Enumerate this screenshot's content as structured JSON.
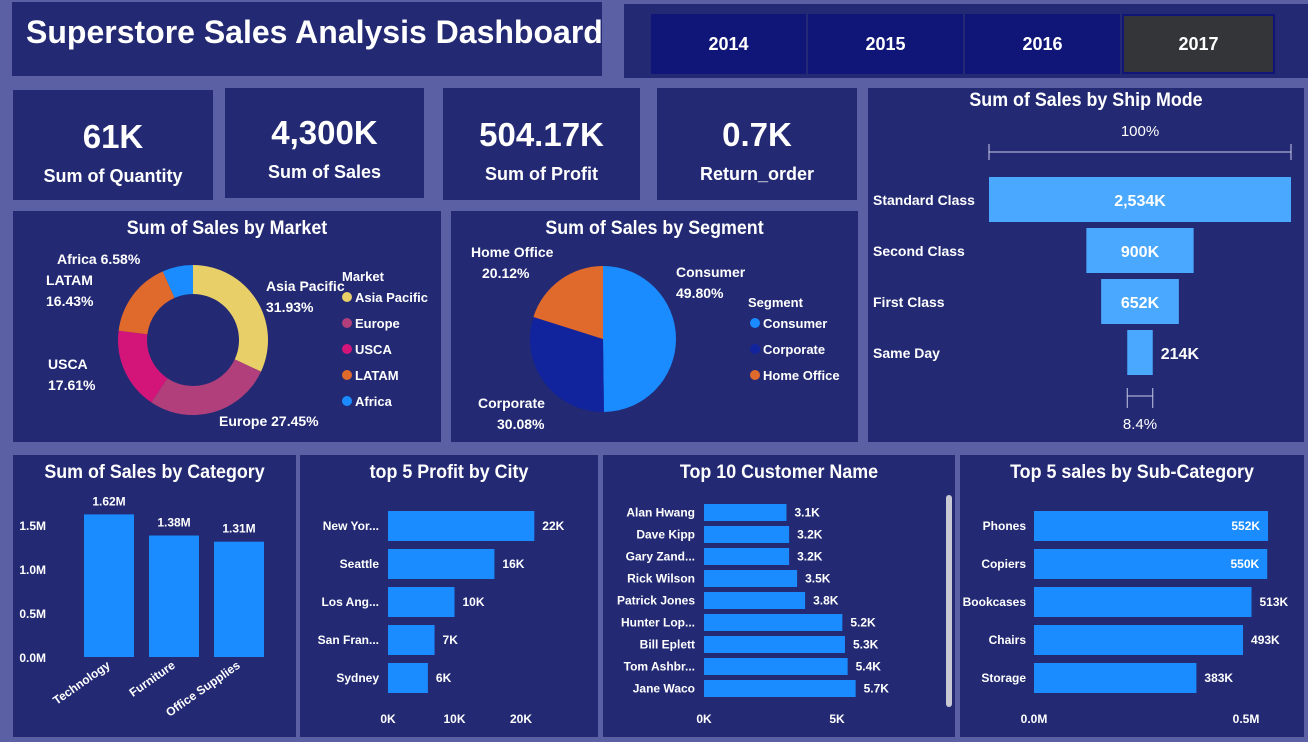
{
  "header": {
    "title": "Superstore Sales Analysis Dashboard"
  },
  "years": {
    "items": [
      "2014",
      "2015",
      "2016",
      "2017"
    ],
    "selected": "2017"
  },
  "kpis": [
    {
      "value": "61K",
      "label": "Sum of Quantity"
    },
    {
      "value": "4,300K",
      "label": "Sum of Sales"
    },
    {
      "value": "504.17K",
      "label": "Sum of Profit"
    },
    {
      "value": "0.7K",
      "label": "Return_order"
    }
  ],
  "colors": {
    "bar": "#1a8cff",
    "funnel": "#4aa8ff",
    "panel": "#232a73",
    "background": "#5b5fa3",
    "asia_pacific": "#e8cf68",
    "europe": "#b03f7b",
    "usca": "#d3157a",
    "latam": "#e06a2c",
    "africa": "#1a8cff",
    "consumer": "#1a8cff",
    "corporate": "#12239e",
    "home_office": "#e06a2c"
  },
  "chart_data": [
    {
      "id": "market",
      "type": "pie",
      "variant": "donut",
      "title": "Sum of Sales by Market",
      "legend_title": "Market",
      "legend_position": "right",
      "categories": [
        "Asia Pacific",
        "Europe",
        "USCA",
        "LATAM",
        "Africa"
      ],
      "values": [
        31.93,
        27.45,
        17.61,
        16.43,
        6.58
      ],
      "value_labels": [
        "31.93%",
        "27.45%",
        "17.61%",
        "16.43%",
        "6.58%"
      ],
      "colors": [
        "#e8cf68",
        "#b03f7b",
        "#d3157a",
        "#e06a2c",
        "#1a8cff"
      ]
    },
    {
      "id": "segment",
      "type": "pie",
      "title": "Sum of Sales by Segment",
      "legend_title": "Segment",
      "legend_position": "right",
      "categories": [
        "Consumer",
        "Corporate",
        "Home Office"
      ],
      "values": [
        49.8,
        30.08,
        20.12
      ],
      "value_labels": [
        "49.80%",
        "30.08%",
        "20.12%"
      ],
      "colors": [
        "#1a8cff",
        "#12239e",
        "#e06a2c"
      ]
    },
    {
      "id": "shipmode",
      "type": "bar",
      "variant": "funnel",
      "title": "Sum of Sales by Ship Mode",
      "top_label": "100%",
      "bottom_label": "8.4%",
      "categories": [
        "Standard Class",
        "Second Class",
        "First Class",
        "Same Day"
      ],
      "values": [
        2534,
        900,
        652,
        214
      ],
      "value_labels": [
        "2,534K",
        "900K",
        "652K",
        "214K"
      ]
    },
    {
      "id": "category",
      "type": "bar",
      "title": "Sum of Sales by Category",
      "categories": [
        "Technology",
        "Furniture",
        "Office Supplies"
      ],
      "values": [
        1.62,
        1.38,
        1.31
      ],
      "value_labels": [
        "1.62M",
        "1.38M",
        "1.31M"
      ],
      "ylim": [
        0,
        1.67
      ],
      "yticks": [
        0,
        0.5,
        1.0,
        1.5
      ],
      "ytick_labels": [
        "0.0M",
        "0.5M",
        "1.0M",
        "1.5M"
      ]
    },
    {
      "id": "city",
      "type": "bar",
      "orientation": "horizontal",
      "title": "top 5 Profit by City",
      "categories": [
        "New Yor...",
        "Seattle",
        "Los Ang...",
        "San Fran...",
        "Sydney"
      ],
      "values": [
        22,
        16,
        10,
        7,
        6
      ],
      "value_labels": [
        "22K",
        "16K",
        "10K",
        "7K",
        "6K"
      ],
      "xlim": [
        0,
        20
      ],
      "xticks": [
        0,
        10,
        20
      ],
      "xtick_labels": [
        "0K",
        "10K",
        "20K"
      ]
    },
    {
      "id": "customer",
      "type": "bar",
      "orientation": "horizontal",
      "title": "Top 10 Customer Name",
      "categories": [
        "Alan Hwang",
        "Dave Kipp",
        "Gary Zand...",
        "Rick Wilson",
        "Patrick Jones",
        "Hunter Lop...",
        "Bill Eplett",
        "Tom Ashbr...",
        "Jane Waco"
      ],
      "values": [
        3.1,
        3.2,
        3.2,
        3.5,
        3.8,
        5.2,
        5.3,
        5.4,
        5.7
      ],
      "value_labels": [
        "3.1K",
        "3.2K",
        "3.2K",
        "3.5K",
        "3.8K",
        "5.2K",
        "5.3K",
        "5.4K",
        "5.7K"
      ],
      "xlim": [
        0,
        5
      ],
      "xticks": [
        0,
        5
      ],
      "xtick_labels": [
        "0K",
        "5K"
      ]
    },
    {
      "id": "subcategory",
      "type": "bar",
      "orientation": "horizontal",
      "title": "Top 5 sales by Sub-Category",
      "categories": [
        "Phones",
        "Copiers",
        "Bookcases",
        "Chairs",
        "Storage"
      ],
      "values": [
        552,
        550,
        513,
        493,
        383
      ],
      "value_labels": [
        "552K",
        "550K",
        "513K",
        "493K",
        "383K"
      ],
      "xlim": [
        0,
        500
      ],
      "xticks": [
        0,
        500
      ],
      "xtick_labels": [
        "0.0M",
        "0.5M"
      ]
    }
  ]
}
